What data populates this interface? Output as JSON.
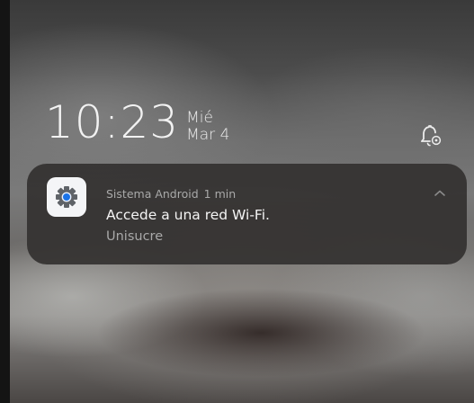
{
  "lockscreen": {
    "time": "10:23",
    "weekday": "Mié",
    "date": "Mar 4"
  },
  "notification": {
    "app_name": "Sistema Android",
    "timestamp": "1 min",
    "title": "Accede a una red Wi-Fi.",
    "body": "Unisucre",
    "app_icon": "settings-gear-icon",
    "expand_icon": "chevron-up-icon"
  },
  "status": {
    "bell_icon": "notification-settings-bell-icon"
  },
  "colors": {
    "gear_blue": "#1a73e8",
    "gear_gray": "#5f6368",
    "card_bg": "#343230"
  }
}
